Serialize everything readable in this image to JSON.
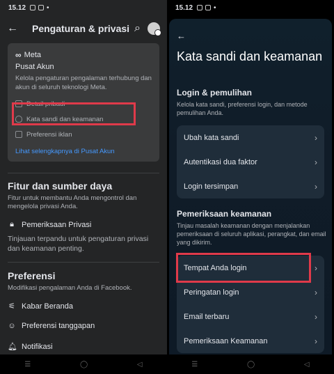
{
  "left": {
    "status": {
      "time": "15.12",
      "battery": "44"
    },
    "header": {
      "title": "Pengaturan & privasi"
    },
    "meta_card": {
      "logo_text": "Meta",
      "title": "Pusat Akun",
      "description": "Kelola pengaturan pengalaman terhubung dan akun di seluruh teknologi Meta.",
      "items": [
        {
          "label": "Detail pribadi"
        },
        {
          "label": "Kata sandi dan keamanan"
        },
        {
          "label": "Preferensi iklan"
        }
      ],
      "more_link": "Lihat selengkapnya di Pusat Akun"
    },
    "features": {
      "title": "Fitur dan sumber daya",
      "description": "Fitur untuk membantu Anda mengontrol dan mengelola privasi Anda.",
      "row_label": "Pemeriksaan Privasi",
      "row_sub": "Tinjauan terpandu untuk pengaturan privasi dan keamanan penting."
    },
    "preferences": {
      "title": "Preferensi",
      "description": "Modifikasi pengalaman Anda di Facebook.",
      "items": [
        {
          "label": "Kabar Beranda"
        },
        {
          "label": "Preferensi tanggapan"
        },
        {
          "label": "Notifikasi"
        }
      ]
    }
  },
  "right": {
    "status": {
      "time": "15.12",
      "battery": "44"
    },
    "title": "Kata sandi dan keamanan",
    "login_section": {
      "title": "Login & pemulihan",
      "description": "Kelola kata sandi, preferensi login, dan metode pemulihan Anda.",
      "items": [
        {
          "label": "Ubah kata sandi"
        },
        {
          "label": "Autentikasi dua faktor"
        },
        {
          "label": "Login tersimpan"
        }
      ]
    },
    "security_section": {
      "title": "Pemeriksaan keamanan",
      "description": "Tinjau masalah keamanan dengan menjalankan pemeriksaan di seluruh aplikasi, perangkat, dan email yang dikirim.",
      "items": [
        {
          "label": "Tempat Anda login"
        },
        {
          "label": "Peringatan login"
        },
        {
          "label": "Email terbaru"
        },
        {
          "label": "Pemeriksaan Keamanan"
        }
      ]
    }
  },
  "colors": {
    "highlight": "#e03a4a",
    "link": "#4599ff"
  }
}
